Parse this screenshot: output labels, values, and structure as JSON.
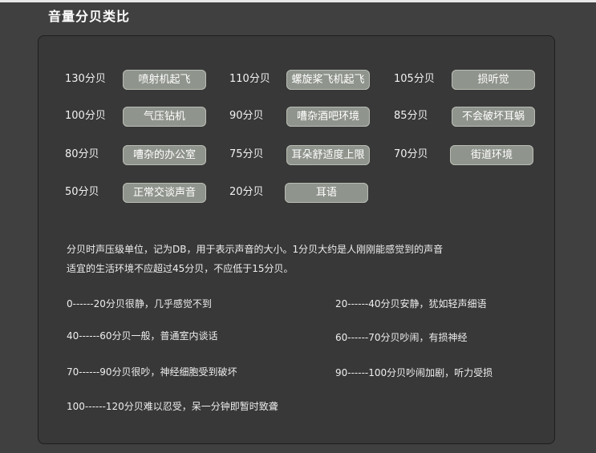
{
  "title": "音量分贝类比",
  "levels": [
    {
      "label": "130分贝",
      "env": "喷射机起飞"
    },
    {
      "label": "110分贝",
      "env": "螺旋桨飞机起飞"
    },
    {
      "label": "105分贝",
      "env": "损听觉"
    },
    {
      "label": "100分贝",
      "env": "气压钻机"
    },
    {
      "label": "90分贝",
      "env": "嘈杂酒吧环境"
    },
    {
      "label": "85分贝",
      "env": "不会破坏耳蜗"
    },
    {
      "label": "80分贝",
      "env": "嘈杂的办公室"
    },
    {
      "label": "75分贝",
      "env": "耳朵舒适度上限"
    },
    {
      "label": "70分贝",
      "env": "街道环境"
    },
    {
      "label": "50分贝",
      "env": "正常交谈声音"
    },
    {
      "label": "20分贝",
      "env": "耳语"
    }
  ],
  "description": [
    "分贝时声压级单位，记为DB，用于表示声音的大小。1分贝大约是人刚刚能感觉到的声音",
    "适宜的生活环境不应超过45分贝，不应低于15分贝。"
  ],
  "ranges": [
    "0------20分贝很静，几乎感觉不到",
    "20------40分贝安静，犹如轻声细语",
    "40------60分贝一般，普通室内谈话",
    "60------70分贝吵闹，有损神经",
    "70------90分贝很吵，神经细胞受到破坏",
    "90------100分贝吵闹加剧，听力受损",
    "100------120分贝难以忍受，呆一分钟即暂时致聋"
  ]
}
